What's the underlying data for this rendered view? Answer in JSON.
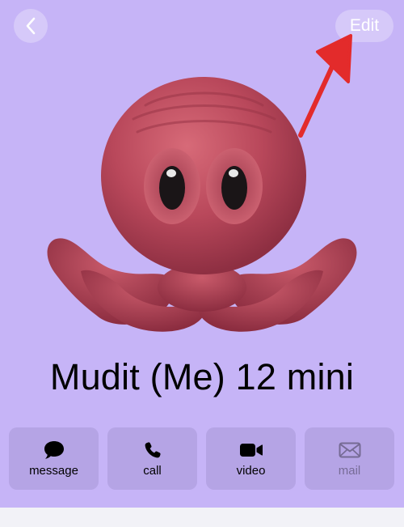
{
  "nav": {
    "back_icon": "chevron-left-icon",
    "edit_label": "Edit"
  },
  "contact": {
    "name": "Mudit (Me) 12 mini",
    "avatar": "octopus-memoji"
  },
  "actions": [
    {
      "label": "message",
      "icon": "message-bubble-icon",
      "enabled": true
    },
    {
      "label": "call",
      "icon": "phone-icon",
      "enabled": true
    },
    {
      "label": "video",
      "icon": "video-camera-icon",
      "enabled": true
    },
    {
      "label": "mail",
      "icon": "envelope-icon",
      "enabled": false
    }
  ],
  "colors": {
    "poster_background": "#c6b4f7",
    "octopus_body": "#b84a5c",
    "annotation_arrow": "#e32b2b"
  }
}
